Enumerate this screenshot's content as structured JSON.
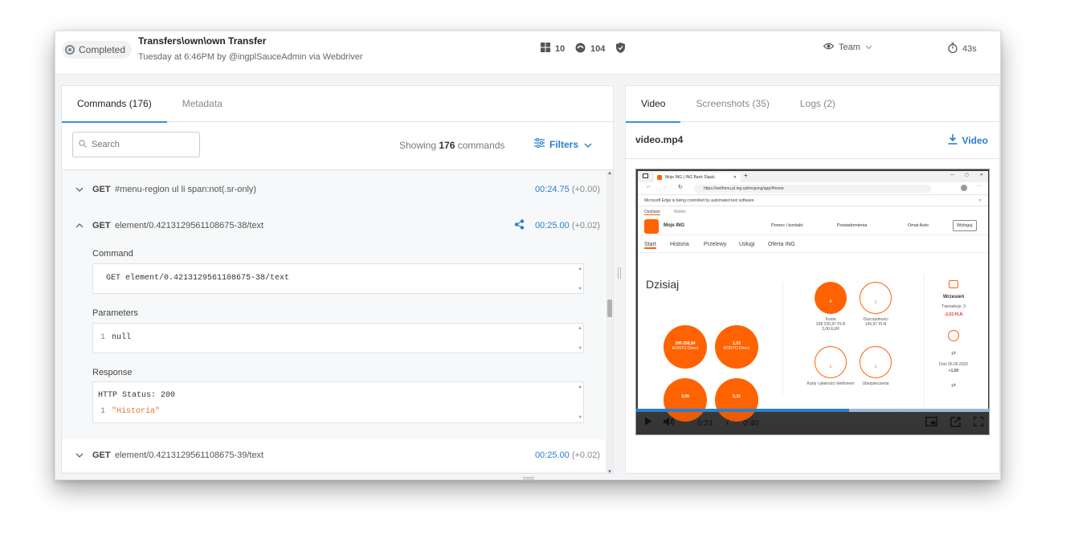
{
  "header": {
    "status": "Completed",
    "title": "Transfers\\own\\own Transfer",
    "subtitle": "Tuesday at 6:46PM by @ingplSauceAdmin via Webdriver",
    "os_version": "10",
    "browser_version": "104",
    "team_label": "Team",
    "duration": "43s"
  },
  "left_panel": {
    "tabs": [
      "Commands (176)",
      "Metadata"
    ],
    "search_placeholder": "Search",
    "showing_prefix": "Showing ",
    "showing_count": "176",
    "showing_suffix": " commands",
    "filters_label": "Filters",
    "commands": [
      {
        "method": "GET",
        "target": "#menu-region ul li span:not(.sr-only)",
        "time": "00:24.75",
        "delta": "(+0.00)",
        "expanded": false
      },
      {
        "method": "GET",
        "target": "element/0.4213129561108675-38/text",
        "time": "00:25.00",
        "delta": "(+0.02)",
        "expanded": true
      },
      {
        "method": "GET",
        "target": "element/0.4213129561108675-39/text",
        "time": "00:25.00",
        "delta": "(+0.02)",
        "expanded": false
      }
    ],
    "detail": {
      "command_label": "Command",
      "command_text": "GET element/0.4213129561108675-38/text",
      "parameters_label": "Parameters",
      "parameters_line": "1",
      "parameters_value": "null",
      "response_label": "Response",
      "response_status": "HTTP Status: 200",
      "response_line": "1",
      "response_value": "\"Historia\""
    }
  },
  "right_panel": {
    "tabs": [
      "Video",
      "Screenshots (35)",
      "Logs (2)"
    ],
    "file_name": "video.mp4",
    "download_label": "Video",
    "video": {
      "current_time": "0:24",
      "separator": "/",
      "total_time": "0:40",
      "progress": 0.6,
      "browser": {
        "tab_title": "Moje ING | ING Bank Śląski",
        "url": "https://wolfrenu.pl.ing-ad/mojeing/app/#home",
        "info_bar": "Microsoft Edge is being controlled by automated test software.",
        "top_links": [
          "Osobiste",
          "Makler"
        ],
        "brand": "Moje ING",
        "nav_items": [
          "Pomoc i kontakt",
          "Powiadomienia",
          "Omat Auto"
        ],
        "logout": "Wyloguj",
        "tabs": [
          "Start",
          "Historia",
          "Przelewy",
          "Usługi",
          "Oferta ING"
        ],
        "page_title": "Dzisiaj",
        "balances": [
          {
            "amount": "299 258,84",
            "currency": "PLN",
            "label": "KONTO Direct"
          },
          {
            "amount": "1,03",
            "currency": "PLN",
            "label": "KONTO Direct"
          },
          {
            "amount": "3,00",
            "currency": "EUR",
            "label": ""
          },
          {
            "amount": "5,32",
            "currency": "USD",
            "label": ""
          }
        ],
        "tiles": [
          {
            "count": "4",
            "label": "Konta",
            "sub1": "299 235,87 PLN",
            "sub2": "3,00 EUR"
          },
          {
            "count": "1",
            "label": "Oszczędności",
            "sub1": "145,97 PLN",
            "sub2": ""
          },
          {
            "count": "1",
            "label": "Karty i płatności telefonem",
            "sub1": "",
            "sub2": ""
          },
          {
            "count": "1",
            "label": "Ubezpieczenia",
            "sub1": "",
            "sub2": ""
          }
        ],
        "side": {
          "month": "Wrzesień",
          "transactions": "Transakcje: 3",
          "amount": "-2,03 PLN",
          "date1": "Dziś 06.09.2022",
          "amt1": "+1,00"
        }
      }
    }
  },
  "colors": {
    "accent": "#2a7fcf",
    "ing_orange": "#ff6200",
    "response_string": "#e0782f"
  }
}
